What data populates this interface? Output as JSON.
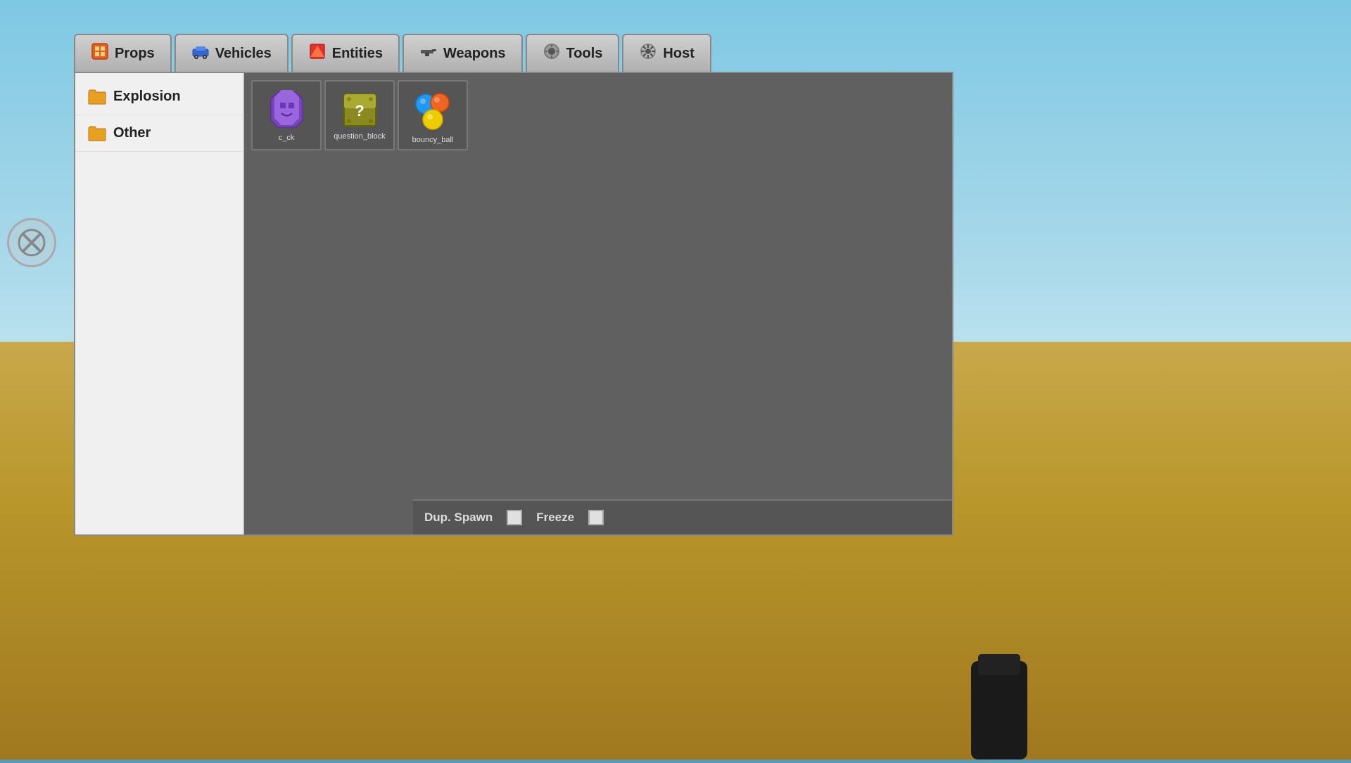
{
  "background": {
    "sky_color_top": "#7ec8e3",
    "sky_color_bottom": "#c8e8f0",
    "ground_color_top": "#c8a84b",
    "ground_color_bottom": "#a07820"
  },
  "tabs": [
    {
      "id": "props",
      "label": "Props",
      "icon": "🧱",
      "active": false
    },
    {
      "id": "vehicles",
      "label": "Vehicles",
      "icon": "🚗",
      "active": false
    },
    {
      "id": "entities",
      "label": "Entities",
      "icon": "📦",
      "active": false
    },
    {
      "id": "weapons",
      "label": "Weapons",
      "icon": "🔫",
      "active": false
    },
    {
      "id": "tools",
      "label": "Tools",
      "icon": "🔧",
      "active": false
    },
    {
      "id": "host",
      "label": "Host",
      "icon": "⚙️",
      "active": false
    }
  ],
  "sidebar": {
    "items": [
      {
        "id": "explosion",
        "label": "Explosion"
      },
      {
        "id": "other",
        "label": "Other"
      }
    ]
  },
  "items": [
    {
      "id": "c_ck",
      "label": "c_ck",
      "type": "c_ck"
    },
    {
      "id": "question_block",
      "label": "question_block",
      "type": "question_block"
    },
    {
      "id": "bouncy_ball",
      "label": "bouncy_ball",
      "type": "bouncy_ball"
    }
  ],
  "bottom_bar": {
    "dup_spawn_label": "Dup. Spawn",
    "freeze_label": "Freeze"
  }
}
